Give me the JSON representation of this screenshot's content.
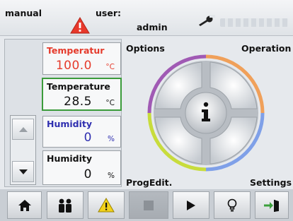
{
  "header": {
    "mode": "manual",
    "user_label": "user:",
    "user_name": "admin",
    "warning_icon": "warning-triangle-icon",
    "service_icon": "wrench-icon"
  },
  "sensors": [
    {
      "label": "Temperatur",
      "value": "100.0",
      "unit": "°C",
      "color": "#e53b2c"
    },
    {
      "label": "Temperature",
      "value": "28.5",
      "unit": "°C",
      "color": "#111111",
      "selected": true
    },
    {
      "label": "Humidity",
      "value": "0",
      "unit": "%",
      "color": "#2f2fb0"
    },
    {
      "label": "Humidity",
      "value": "0",
      "unit": "%",
      "color": "#111111"
    }
  ],
  "arrows": {
    "up_icon": "arrow-up-icon",
    "down_icon": "arrow-down-icon"
  },
  "dial": {
    "top_left": "Options",
    "top_right": "Operation",
    "bottom_left": "ProgEdit.",
    "bottom_right": "Settings",
    "center_icon": "info-icon",
    "arc_colors": [
      "#a05ab4",
      "#f0a05a",
      "#7fa0e8",
      "#c8dc3c"
    ]
  },
  "toolbar": {
    "items": [
      "home-icon",
      "users-icon",
      "warning-icon",
      "stop-icon",
      "play-icon",
      "lightbulb-icon",
      "exit-icon"
    ],
    "accent_color": "#3ca03c"
  }
}
